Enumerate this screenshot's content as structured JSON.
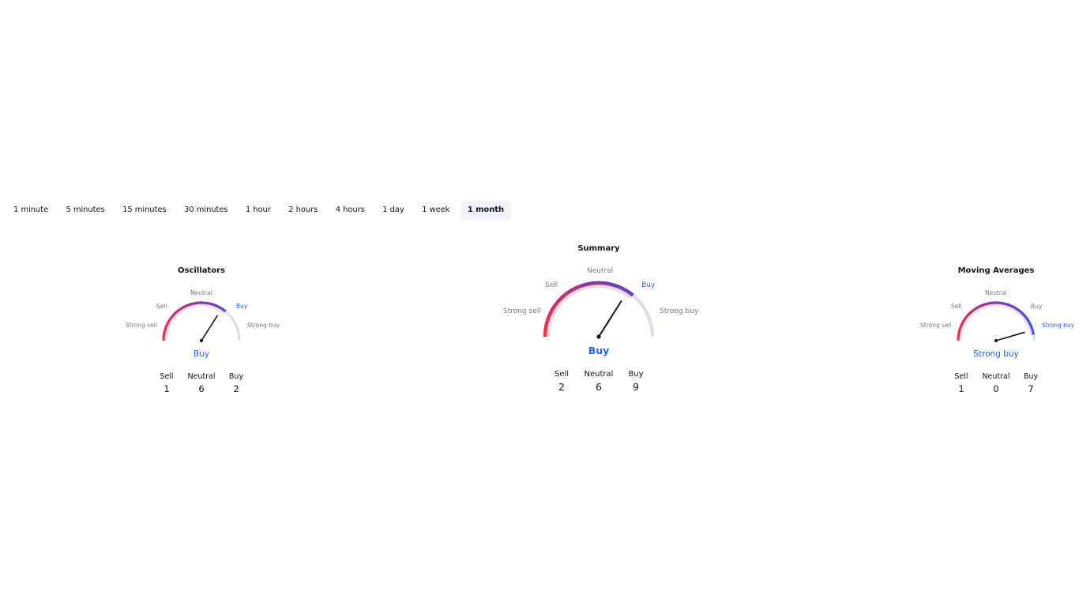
{
  "timeframes": {
    "items": [
      "1 minute",
      "5 minutes",
      "15 minutes",
      "30 minutes",
      "1 hour",
      "2 hours",
      "4 hours",
      "1 day",
      "1 week",
      "1 month"
    ],
    "active_index": 9
  },
  "colors": {
    "sell_red": "#f23645",
    "neutral_purple": "#7e3aa6",
    "buy_blue": "#2962ff",
    "track_grey": "#dcdfe8",
    "trail_pink": "#f7cfd3",
    "needle": "#131722",
    "active_tab_bg": "#f0f3fa"
  },
  "scale_labels": {
    "strong_sell": "Strong sell",
    "sell": "Sell",
    "neutral": "Neutral",
    "buy": "Buy",
    "strong_buy": "Strong buy"
  },
  "gauges": {
    "oscillators": {
      "title": "Oscillators",
      "verdict": "Buy",
      "active_label": "buy",
      "needle_level": 0.68,
      "fill_level": 0.72,
      "counts": {
        "sell_label": "Sell",
        "neutral_label": "Neutral",
        "buy_label": "Buy",
        "sell": "1",
        "neutral": "6",
        "buy": "2"
      }
    },
    "summary": {
      "title": "Summary",
      "verdict": "Buy",
      "active_label": "buy",
      "needle_level": 0.68,
      "fill_level": 0.72,
      "counts": {
        "sell_label": "Sell",
        "neutral_label": "Neutral",
        "buy_label": "Buy",
        "sell": "2",
        "neutral": "6",
        "buy": "9"
      }
    },
    "moving_averages": {
      "title": "Moving Averages",
      "verdict": "Strong buy",
      "active_label": "strong_buy",
      "needle_level": 0.91,
      "fill_level": 0.95,
      "counts": {
        "sell_label": "Sell",
        "neutral_label": "Neutral",
        "buy_label": "Buy",
        "sell": "1",
        "neutral": "0",
        "buy": "7"
      }
    }
  }
}
